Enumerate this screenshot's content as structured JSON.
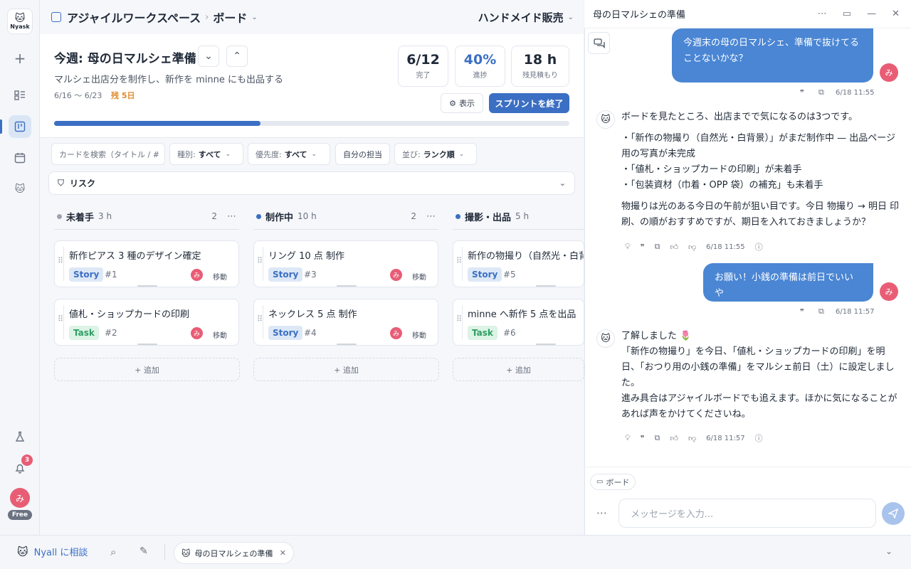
{
  "app": {
    "logo_text": "Nyask",
    "plan": "Free",
    "user_initial": "み",
    "notification_count": "3"
  },
  "breadcrumb": {
    "workspace": "アジャイルワークスペース",
    "separator": "›",
    "page": "ボード",
    "project": "ハンドメイド販売"
  },
  "sprint": {
    "title": "今週: 母の日マルシェ準備",
    "goal": "マルシェ出店分を制作し、新作を minne にも出品する",
    "dates": "6/16 〜 6/23",
    "remaining": "残 5日",
    "progress": 0.4,
    "stats": [
      {
        "value": "6/12",
        "label": "完了"
      },
      {
        "value": "40%",
        "label": "進捗"
      },
      {
        "value": "18 h",
        "label": "残見積もり"
      }
    ],
    "view_label": "表示",
    "end_label": "スプリントを終了"
  },
  "filters": {
    "search_placeholder": "カードを検索（タイトル / #",
    "type_label": "種別:",
    "type_value": "すべて",
    "priority_label": "優先度:",
    "priority_value": "すべて",
    "mine_label": "自分の担当",
    "sort_label": "並び:",
    "sort_value": "ランク順"
  },
  "risk_label": "リスク",
  "columns": [
    {
      "name": "未着手",
      "hours": "3 h",
      "count": "2",
      "color": "#9ca3af",
      "cards": [
        {
          "title": "新作ピアス 3 種のデザイン確定",
          "type": "Story",
          "num": "#1",
          "assignee": "み",
          "move": "移動"
        },
        {
          "title": "値札・ショップカードの印刷",
          "type": "Task",
          "num": "#2",
          "assignee": "み",
          "move": "移動"
        }
      ],
      "add": "+ 追加"
    },
    {
      "name": "制作中",
      "hours": "10 h",
      "count": "2",
      "color": "#3b6fc4",
      "cards": [
        {
          "title": "リング 10 点 制作",
          "type": "Story",
          "num": "#3",
          "assignee": "み",
          "move": "移動"
        },
        {
          "title": "ネックレス 5 点 制作",
          "type": "Story",
          "num": "#4",
          "assignee": "み",
          "move": "移動"
        }
      ],
      "add": "+ 追加"
    },
    {
      "name": "撮影・出品",
      "hours": "5 h",
      "count": "",
      "color": "#3b6fc4",
      "cards": [
        {
          "title": "新作の物撮り（自然光・白背",
          "type": "Story",
          "num": "#5"
        },
        {
          "title": "minne へ新作 5 点を出品",
          "type": "Task",
          "num": "#6"
        }
      ],
      "add": "+ 追加"
    }
  ],
  "chat": {
    "title": "母の日マルシェの準備",
    "messages": [
      {
        "role": "user",
        "text": "今週末の母の日マルシェ、準備で抜けてることないかな？",
        "time": "6/18 11:55"
      },
      {
        "role": "bot",
        "lines": [
          "ボードを見たところ、出店までで気になるのは3つです。",
          "・「新作の物撮り（自然光・白背景）」がまだ制作中 — 出品ページ用の写真が未完成",
          "・「値札・ショップカードの印刷」が未着手",
          "・「包装資材（巾着・OPP 袋）の補充」も未着手",
          "物撮りは光のある今日の午前が狙い目です。今日 物撮り → 明日 印刷、の順がおすすめですが、期日を入れておきましょうか？"
        ],
        "time": "6/18 11:55"
      },
      {
        "role": "user",
        "text": "お願い！小銭の準備は前日でいいや",
        "time": "6/18 11:57"
      },
      {
        "role": "bot",
        "lines": [
          "了解しました 🌷",
          "「新作の物撮り」を今日、「値札・ショップカードの印刷」を明日、「おつり用の小銭の準備」をマルシェ前日（土）に設定しました。",
          "進み具合はアジャイルボードでも追えます。ほかに気になることがあれば声をかけてくださいね。"
        ],
        "time": "6/18 11:57"
      }
    ],
    "context_chip": "ボード",
    "input_placeholder": "メッセージを入力..."
  },
  "bottom": {
    "consult_label": "Nyall に相談",
    "tab_label": "母の日マルシェの準備"
  }
}
